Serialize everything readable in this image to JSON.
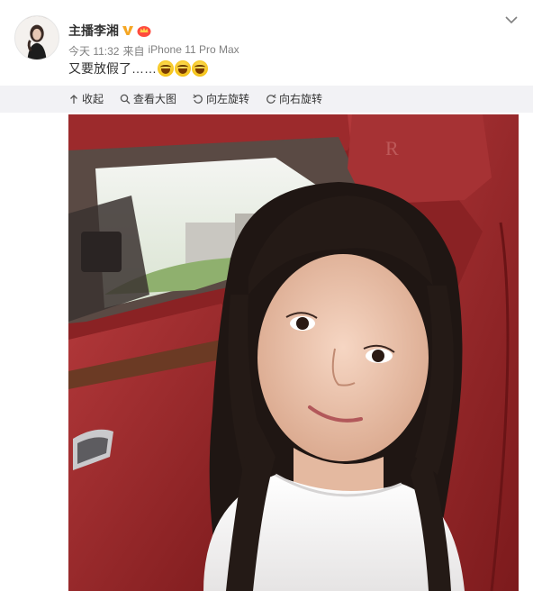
{
  "user": {
    "name": "主播李湘",
    "verified_icon": "gold-v-verified-icon",
    "vip_icon": "crown-vip-icon"
  },
  "meta": {
    "time": "今天 11:32",
    "source_prefix": "来自",
    "source": "iPhone 11 Pro Max"
  },
  "post": {
    "text": "又要放假了……",
    "emoji": [
      "laugh-cry-emoji",
      "laugh-cry-emoji",
      "laugh-cry-emoji"
    ]
  },
  "toolbar": {
    "collapse_label": "收起",
    "view_large_label": "查看大图",
    "rotate_left_label": "向左旋转",
    "rotate_right_label": "向右旋转"
  },
  "colors": {
    "bar_bg": "#f2f2f5",
    "meta_text": "#808080",
    "seat_red": "#8e2020",
    "verified_gold": "#f5a623"
  }
}
